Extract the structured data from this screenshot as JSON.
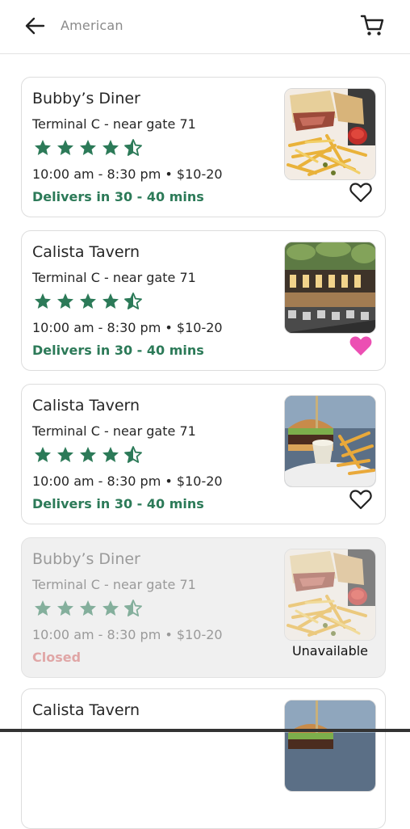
{
  "header": {
    "search_text": "American",
    "icons": {
      "back": "arrow-left-icon",
      "cart": "shopping-cart-icon"
    }
  },
  "colors": {
    "star": "#2c7a58",
    "delivery_text": "#2c7a58",
    "closed_text": "#e0a6a6",
    "favorite_filled": "#ec4fb3"
  },
  "restaurants": [
    {
      "name": "Bubby’s Diner",
      "location": "Terminal C - near gate 71",
      "rating": 4.5,
      "hours": "10:00 am - 8:30 pm",
      "separator": "•",
      "price": "$10-20",
      "delivery": "Delivers in 30 - 40 mins",
      "favorite": false,
      "photo": "sandwich-fries-photo"
    },
    {
      "name": "Calista Tavern",
      "location": "Terminal C - near gate 71",
      "rating": 4.5,
      "hours": "10:00 am - 8:30 pm",
      "separator": "•",
      "price": "$10-20",
      "delivery": "Delivers in 30 - 40 mins",
      "favorite": true,
      "photo": "restaurant-interior-photo"
    },
    {
      "name": "Calista Tavern",
      "location": "Terminal C - near gate 71",
      "rating": 4.5,
      "hours": "10:00 am - 8:30 pm",
      "separator": "•",
      "price": "$10-20",
      "delivery": "Delivers in 30 - 40 mins",
      "favorite": false,
      "photo": "burger-fries-photo"
    },
    {
      "name": "Bubby’s Diner",
      "location": "Terminal C - near gate 71",
      "rating": 4.5,
      "hours": "10:00 am - 8:30 pm",
      "separator": "•",
      "price": "$10-20",
      "delivery": "Closed",
      "status_label": "Unavailable",
      "photo": "sandwich-fries-photo"
    },
    {
      "name": "Calista Tavern",
      "photo": "burger-fries-photo"
    }
  ]
}
